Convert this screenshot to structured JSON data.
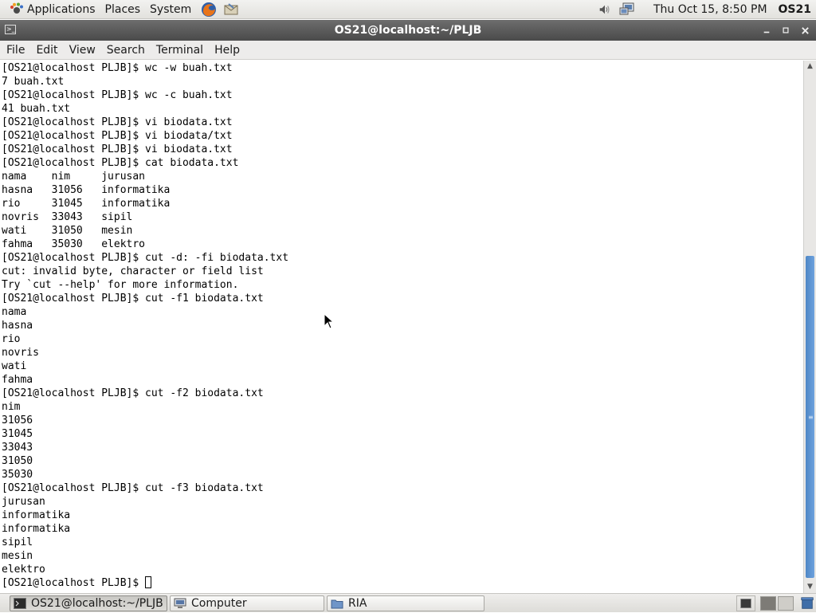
{
  "top_panel": {
    "menus": [
      "Applications",
      "Places",
      "System"
    ],
    "clock": "Thu Oct 15,  8:50 PM",
    "user": "OS21"
  },
  "window": {
    "title": "OS21@localhost:~/PLJB"
  },
  "menubar": [
    "File",
    "Edit",
    "View",
    "Search",
    "Terminal",
    "Help"
  ],
  "terminal": {
    "lines": [
      "[OS21@localhost PLJB]$ wc -w buah.txt",
      "7 buah.txt",
      "[OS21@localhost PLJB]$ wc -c buah.txt",
      "41 buah.txt",
      "[OS21@localhost PLJB]$ vi biodata.txt",
      "[OS21@localhost PLJB]$ vi biodata/txt",
      "[OS21@localhost PLJB]$ vi biodata.txt",
      "[OS21@localhost PLJB]$ cat biodata.txt",
      "nama    nim     jurusan",
      "hasna   31056   informatika",
      "rio     31045   informatika",
      "novris  33043   sipil",
      "wati    31050   mesin",
      "fahma   35030   elektro",
      "[OS21@localhost PLJB]$ cut -d: -fi biodata.txt",
      "cut: invalid byte, character or field list",
      "Try `cut --help' for more information.",
      "[OS21@localhost PLJB]$ cut -f1 biodata.txt",
      "nama",
      "hasna",
      "rio",
      "novris",
      "wati",
      "fahma",
      "[OS21@localhost PLJB]$ cut -f2 biodata.txt",
      "nim",
      "31056",
      "31045",
      "33043",
      "31050",
      "35030",
      "[OS21@localhost PLJB]$ cut -f3 biodata.txt",
      "jurusan",
      "informatika",
      "informatika",
      "sipil",
      "mesin",
      "elektro"
    ],
    "prompt": "[OS21@localhost PLJB]$ "
  },
  "taskbar": {
    "tasks": [
      "OS21@localhost:~/PLJB",
      "Computer",
      "RIA"
    ]
  },
  "colors": {
    "panel_bg": "#e9e8e4",
    "titlebar_bg": "#565656",
    "scroll_thumb": "#5b92d1",
    "terminal_bg": "#ffffff",
    "terminal_fg": "#000000"
  }
}
